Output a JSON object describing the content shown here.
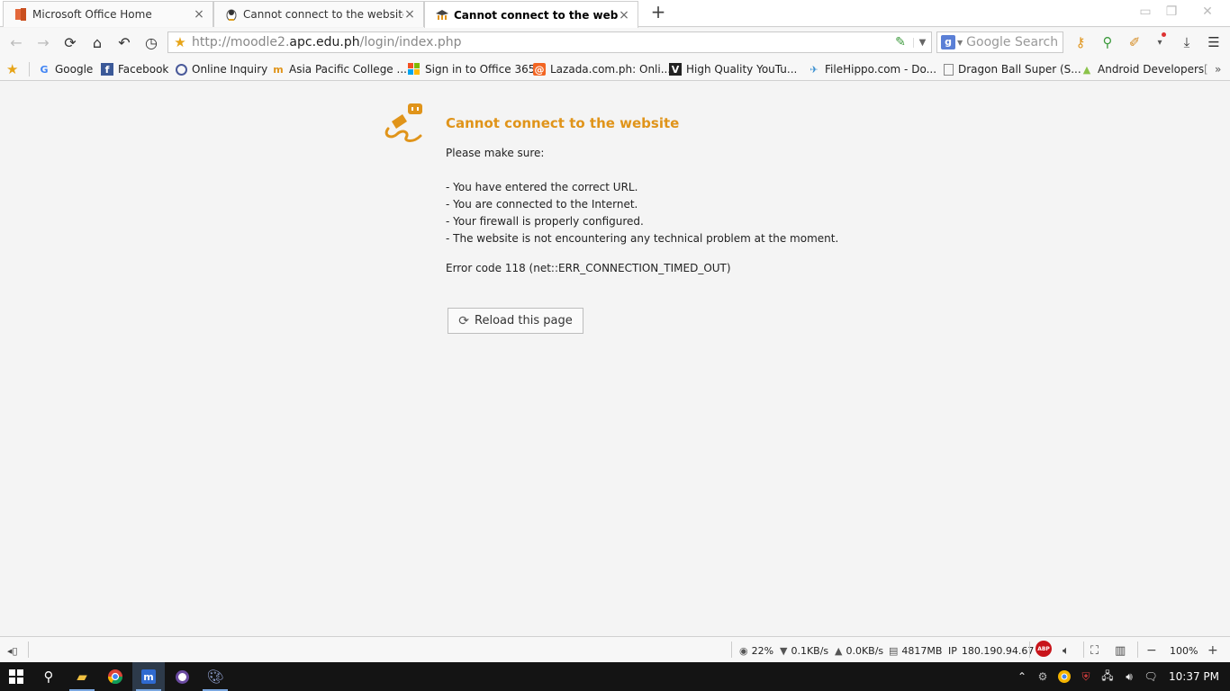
{
  "tabs": [
    {
      "title": "Microsoft Office Home",
      "active": false
    },
    {
      "title": "Cannot connect to the website",
      "active": false
    },
    {
      "title": "Cannot connect to the website",
      "active": true
    }
  ],
  "tab_close": "×",
  "new_tab": "+",
  "address": {
    "prefix": "http://moodle2.",
    "host": "apc.edu.ph",
    "path": "/login/index.php"
  },
  "search": {
    "placeholder": "Google Search"
  },
  "bookmarks": [
    {
      "label": "Google",
      "icon": "google-icon"
    },
    {
      "label": "Facebook",
      "icon": "facebook-icon"
    },
    {
      "label": "Online Inquiry",
      "icon": "globe-icon"
    },
    {
      "label": "Asia Pacific College ...",
      "icon": "moodle-icon"
    },
    {
      "label": "Sign in to Office 365",
      "icon": "windows-icon"
    },
    {
      "label": "Lazada.com.ph: Onli...",
      "icon": "lazada-icon"
    },
    {
      "label": "High Quality YouTu...",
      "icon": "v-icon"
    },
    {
      "label": "FileHippo.com - Do...",
      "icon": "filehippo-icon"
    },
    {
      "label": "Dragon Ball Super (S...",
      "icon": "page-icon"
    },
    {
      "label": "Android Developers",
      "icon": "android-icon"
    }
  ],
  "error": {
    "title": "Cannot connect to the website",
    "intro": "Please make sure:",
    "items": [
      "- You have entered the correct URL.",
      "- You are connected to the Internet.",
      "- Your firewall is properly configured.",
      "- The website is not encountering any technical problem at the moment."
    ],
    "code": "Error code 118 (net::ERR_CONNECTION_TIMED_OUT)",
    "reload_label": "Reload this page"
  },
  "status": {
    "cpu": "22%",
    "down": "0.1KB/s",
    "up": "0.0KB/s",
    "memory": "4817MB",
    "ip_label": "IP",
    "ip": "180.190.94.67",
    "abp": "ABP",
    "zoom": "100%"
  },
  "clock": "10:37 PM",
  "colors": {
    "accent": "#e0941a",
    "star": "#e7a417",
    "abp": "#c8141a"
  }
}
